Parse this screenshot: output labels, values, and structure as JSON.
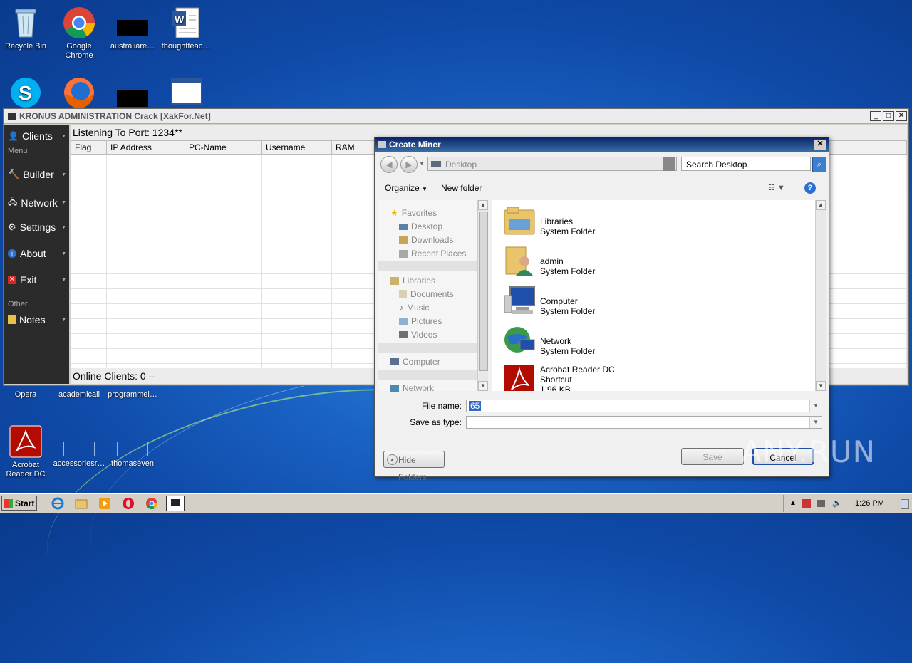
{
  "desktop": {
    "icons": [
      {
        "label": "Recycle Bin"
      },
      {
        "label": "Google\nChrome"
      },
      {
        "label": "australiare…"
      },
      {
        "label": "thoughtteac…"
      },
      {
        "label": "Skype"
      },
      {
        "label": "Firefox"
      },
      {
        "label": "Opera"
      },
      {
        "label": "academicall"
      },
      {
        "label": "programmel…"
      },
      {
        "label": "Acrobat\nReader DC"
      },
      {
        "label": "accessoriesr…"
      },
      {
        "label": "thomaseven"
      }
    ]
  },
  "kronus": {
    "title": "KRONUS ADMINISTRATION Crack [XakFor.Net]",
    "listening": "Listening To Port:  1234**",
    "columns": [
      "Flag",
      "IP Address",
      "PC-Name",
      "Username",
      "RAM"
    ],
    "status": "Online Clients: 0 --",
    "sidebar": {
      "group_menu": "Menu",
      "group_other": "Other",
      "items": [
        "Clients",
        "Builder",
        "Network",
        "Settings",
        "About",
        "Exit",
        "Notes"
      ]
    }
  },
  "dialog": {
    "title": "Create Miner",
    "address": "Desktop",
    "search_placeholder": "Search Desktop",
    "organize": "Organize",
    "new_folder": "New folder",
    "nav": {
      "favorites": "Favorites",
      "desktop": "Desktop",
      "downloads": "Downloads",
      "recent": "Recent Places",
      "libraries": "Libraries",
      "documents": "Documents",
      "music": "Music",
      "pictures": "Pictures",
      "videos": "Videos",
      "computer": "Computer",
      "network": "Network"
    },
    "files": [
      {
        "name": "Libraries",
        "type": "System Folder"
      },
      {
        "name": "admin",
        "type": "System Folder"
      },
      {
        "name": "Computer",
        "type": "System Folder"
      },
      {
        "name": "Network",
        "type": "System Folder"
      },
      {
        "name": "Acrobat Reader DC",
        "type": "Shortcut",
        "size": "1.96 KB"
      }
    ],
    "file_name_label": "File name:",
    "file_name_value": "65",
    "save_as_label": "Save as type:",
    "save_as_value": "",
    "hide_folders": "Hide Folders",
    "save": "Save",
    "cancel": "Cancel"
  },
  "taskbar": {
    "start": "Start",
    "time": "1:26 PM"
  },
  "watermark": "ANY.RUN"
}
